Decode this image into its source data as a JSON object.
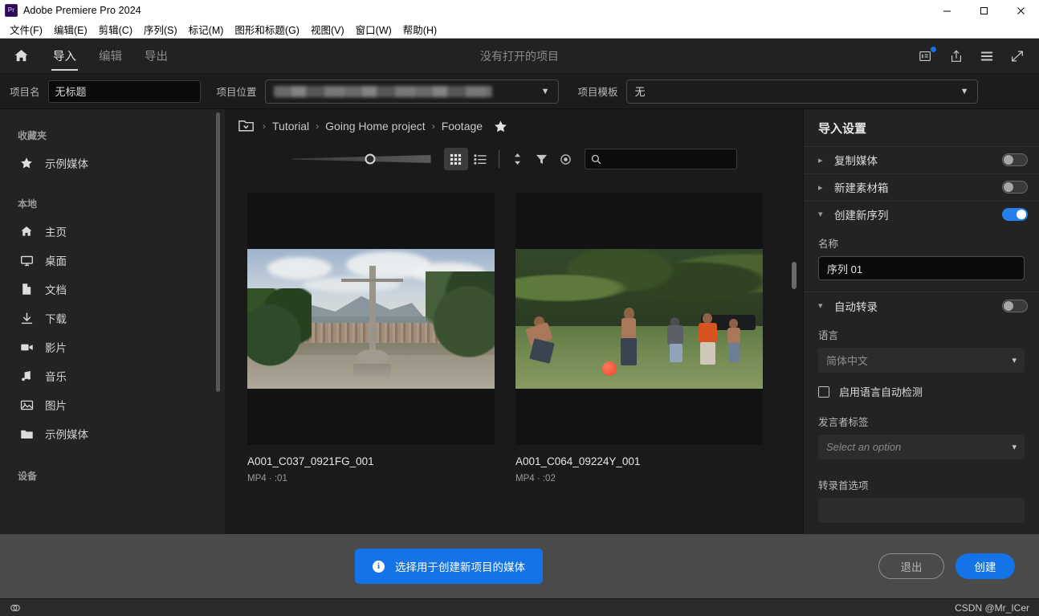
{
  "window": {
    "title": "Adobe Premiere Pro 2024",
    "logo_text": "Pr",
    "minimize": "–",
    "maximize": "☐",
    "close": "✕"
  },
  "menubar": {
    "items": [
      {
        "label": "文件(F)"
      },
      {
        "label": "编辑(E)"
      },
      {
        "label": "剪辑(C)"
      },
      {
        "label": "序列(S)"
      },
      {
        "label": "标记(M)"
      },
      {
        "label": "图形和标题(G)"
      },
      {
        "label": "视图(V)"
      },
      {
        "label": "窗口(W)"
      },
      {
        "label": "帮助(H)"
      }
    ]
  },
  "workspace": {
    "tabs": [
      {
        "label": "导入",
        "active": true
      },
      {
        "label": "编辑",
        "active": false
      },
      {
        "label": "导出",
        "active": false
      }
    ],
    "center_title": "没有打开的项目",
    "icons": [
      {
        "name": "notifications-icon"
      },
      {
        "name": "share-icon"
      },
      {
        "name": "progress-icon"
      },
      {
        "name": "fullscreen-icon"
      }
    ]
  },
  "project_bar": {
    "name_label": "项目名",
    "name_value": "无标题",
    "location_label": "项目位置",
    "location_value": "",
    "template_label": "项目模板",
    "template_value": "无"
  },
  "sidebar": {
    "groups": [
      {
        "title": "收藏夹",
        "items": [
          {
            "label": "示例媒体",
            "icon": "star-icon"
          }
        ]
      },
      {
        "title": "本地",
        "items": [
          {
            "label": "主页",
            "icon": "home-icon"
          },
          {
            "label": "桌面",
            "icon": "monitor-icon"
          },
          {
            "label": "文档",
            "icon": "document-icon"
          },
          {
            "label": "下载",
            "icon": "download-icon"
          },
          {
            "label": "影片",
            "icon": "video-icon"
          },
          {
            "label": "音乐",
            "icon": "music-icon"
          },
          {
            "label": "图片",
            "icon": "image-icon"
          },
          {
            "label": "示例媒体",
            "icon": "folder-icon"
          }
        ]
      },
      {
        "title": "设备",
        "items": []
      }
    ]
  },
  "browser": {
    "breadcrumb": [
      {
        "label": "Tutorial"
      },
      {
        "label": "Going Home project"
      },
      {
        "label": "Footage"
      }
    ],
    "breadcrumb_separator": "›",
    "toolbar": {
      "grid_view": "grid-view-icon",
      "list_view": "list-view-icon",
      "sort": "sort-icon",
      "filter": "filter-icon",
      "preview": "eye-icon",
      "search_placeholder": ""
    },
    "items": [
      {
        "name": "A001_C037_0921FG_001",
        "meta": "MP4 · :01",
        "art": "cross-hill"
      },
      {
        "name": "A001_C064_09224Y_001",
        "meta": "MP4 · :02",
        "art": "soccer-kids"
      }
    ]
  },
  "import_settings": {
    "title": "导入设置",
    "sections": [
      {
        "label": "复制媒体",
        "expanded": false,
        "toggle": false
      },
      {
        "label": "新建素材箱",
        "expanded": false,
        "toggle": false
      },
      {
        "label": "创建新序列",
        "expanded": true,
        "toggle": true
      },
      {
        "label": "自动转录",
        "expanded": true,
        "toggle": false
      }
    ],
    "sequence": {
      "name_label": "名称",
      "name_value": "序列 01"
    },
    "transcription": {
      "language_label": "语言",
      "language_value": "简体中文",
      "autodetect_label": "启用语言自动检测",
      "autodetect_checked": false,
      "speaker_label": "发言者标签",
      "speaker_placeholder": "Select an option",
      "prefs_label": "转录首选项"
    }
  },
  "footer": {
    "info_message": "选择用于创建新项目的媒体",
    "info_icon": "i",
    "cancel_label": "退出",
    "create_label": "创建"
  },
  "statusbar": {
    "cc_icon": "creative-cloud-icon",
    "watermark": "CSDN @Mr_ICer"
  },
  "colors": {
    "accent": "#1473e6",
    "toggle_on": "#2680eb",
    "panel_bg": "#232323",
    "browser_bg": "#1a1a1a",
    "footer_bg": "#4a4a4a"
  }
}
